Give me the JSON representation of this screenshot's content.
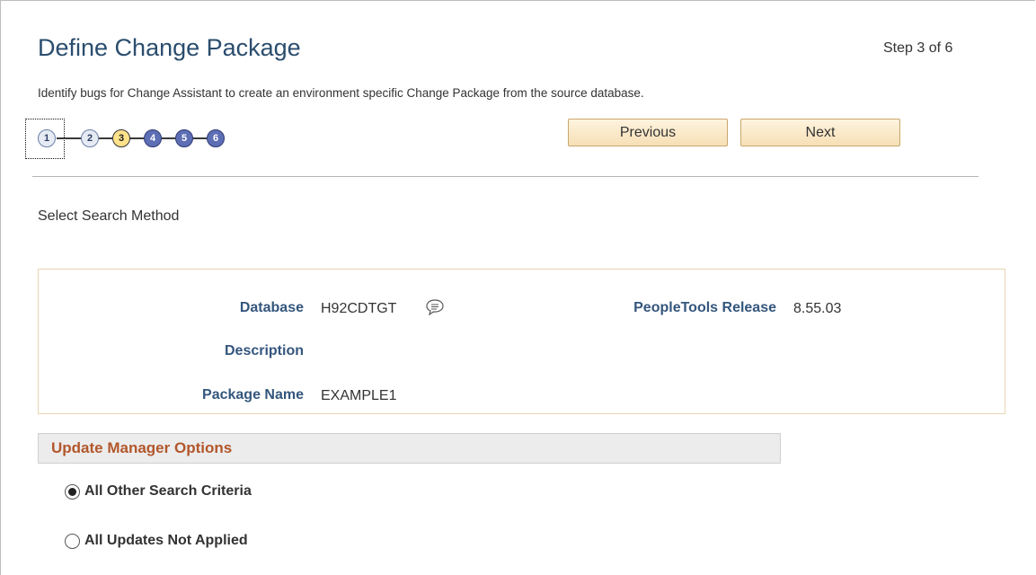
{
  "header": {
    "title": "Define Change Package",
    "step_text": "Step 3 of 6",
    "instructions": "Identify bugs for Change Assistant to create an environment specific Change Package from the source database."
  },
  "stepper": {
    "steps": [
      {
        "label": "1",
        "state": "visited",
        "focused": true
      },
      {
        "label": "2",
        "state": "visited"
      },
      {
        "label": "3",
        "state": "current"
      },
      {
        "label": "4",
        "state": "upcoming"
      },
      {
        "label": "5",
        "state": "upcoming"
      },
      {
        "label": "6",
        "state": "upcoming"
      }
    ]
  },
  "nav": {
    "previous_label": "Previous",
    "next_label": "Next"
  },
  "main": {
    "search_method_label": "Select Search Method",
    "info": {
      "database_label": "Database",
      "database_value": "H92CDTGT",
      "description_label": "Description",
      "description_value": "",
      "package_name_label": "Package Name",
      "package_name_value": "EXAMPLE1",
      "peopletools_label": "PeopleTools Release",
      "peopletools_value": "8.55.03"
    },
    "section_title": "Update Manager Options",
    "options": [
      {
        "label": "All Other Search Criteria",
        "selected": true
      },
      {
        "label": "All Updates Not Applied",
        "selected": false
      }
    ]
  },
  "colors": {
    "title": "#2a4d6e",
    "label": "#34567d",
    "section_title": "#b2572c",
    "step_current": "#ffe28a",
    "step_upcoming": "#5d6eb5",
    "step_visited": "#e6ebf3"
  },
  "icons": {
    "database_related": "speech-bubble-icon"
  }
}
